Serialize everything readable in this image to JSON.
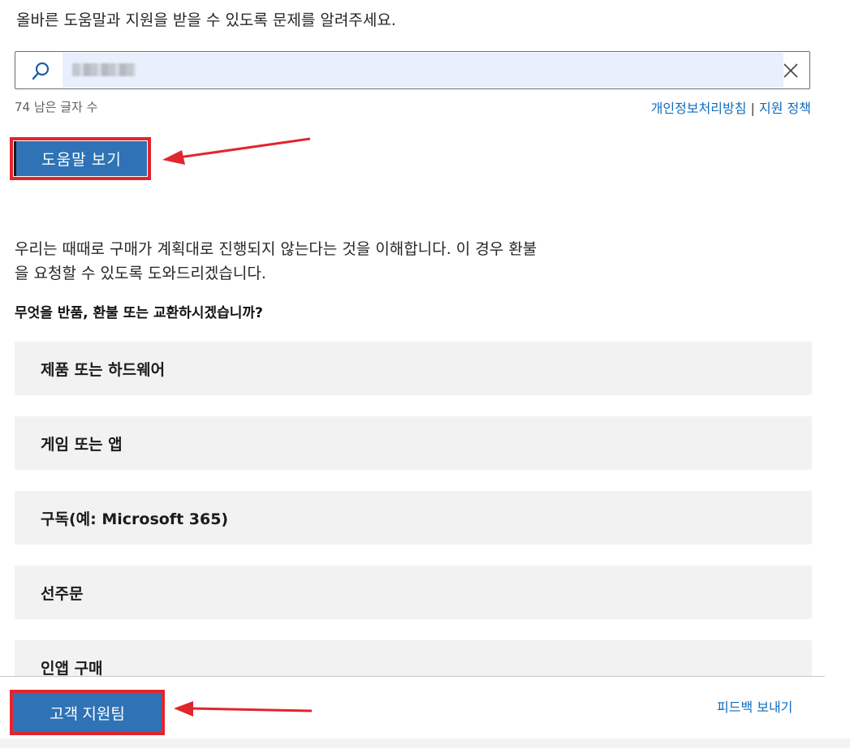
{
  "intro_text": "올바른 도움말과 지원을 받을 수 있도록 문제를 알려주세요.",
  "search": {
    "value": "",
    "placeholder": ""
  },
  "char_count": "74 남은 글자 수",
  "policy": {
    "privacy_label": "개인정보처리방침",
    "separator": "|",
    "support_label": "지원 정책"
  },
  "help_button_label": "도움말 보기",
  "description": {
    "line1": "우리는 때때로 구매가 계획대로 진행되지 않는다는 것을 이해합니다. 이 경우 환불",
    "line2": "을 요청할 수 있도록 도와드리겠습니다."
  },
  "question": "무엇을 반품, 환불 또는 교환하시겠습니까?",
  "options": [
    "제품 또는 하드웨어",
    "게임 또는 앱",
    "구독(예: Microsoft 365)",
    "선주문",
    "인앱 구매"
  ],
  "footer": {
    "support_button_label": "고객 지원팀",
    "feedback_label": "피드백 보내기"
  },
  "colors": {
    "accent_button": "#2f73b6",
    "highlight_box": "#e1252d",
    "link": "#0f6cbd",
    "option_bg": "#f2f2f2"
  }
}
